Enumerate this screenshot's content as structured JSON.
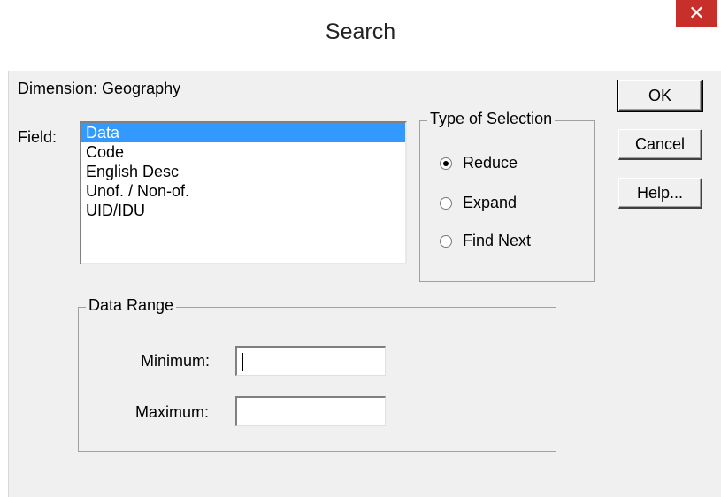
{
  "window": {
    "title": "Search",
    "close_glyph": "✕"
  },
  "dimension_label": "Dimension: Geography",
  "field": {
    "label": "Field:",
    "items": [
      "Data",
      "Code",
      "English Desc",
      "Unof. / Non-of.",
      "UID/IDU"
    ],
    "selected": "Data"
  },
  "selection_type": {
    "title": "Type of Selection",
    "options": [
      "Reduce",
      "Expand",
      "Find Next"
    ],
    "selected": "Reduce"
  },
  "data_range": {
    "title": "Data Range",
    "minimum_label": "Minimum:",
    "minimum_value": "",
    "maximum_label": "Maximum:",
    "maximum_value": ""
  },
  "buttons": {
    "ok": "OK",
    "cancel": "Cancel",
    "help": "Help..."
  },
  "colors": {
    "selection": "#3399ff",
    "close": "#c7302a",
    "dialog_bg": "#f0f0f0"
  }
}
